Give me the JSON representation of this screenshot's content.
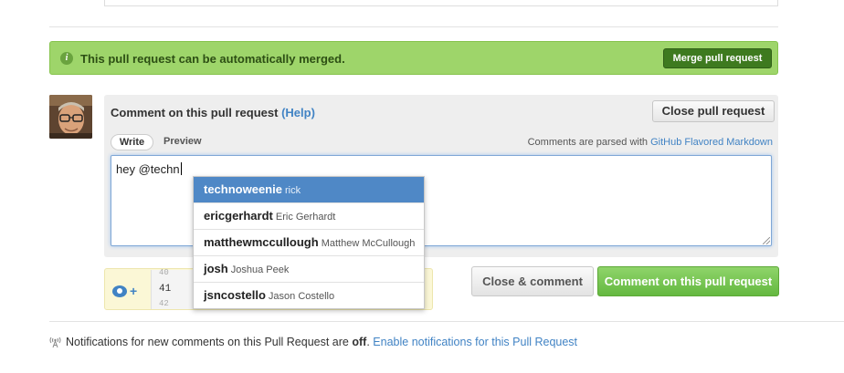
{
  "merge": {
    "message": "This pull request can be automatically merged.",
    "button_label": "Merge pull request",
    "info_glyph": "i",
    "icon": "info-icon"
  },
  "comment": {
    "title": "Comment on this pull request",
    "help_link": "(Help)",
    "close_button": "Close pull request",
    "tabs": [
      {
        "label": "Write",
        "selected": true
      },
      {
        "label": "Preview",
        "selected": false
      }
    ],
    "markdown_note": "Comments are parsed with",
    "markdown_link": "GitHub Flavored Markdown",
    "textarea_value": "hey @techn"
  },
  "suggestions": [
    {
      "login": "technoweenie",
      "name": "rick",
      "active": true
    },
    {
      "login": "ericgerhardt",
      "name": "Eric Gerhardt",
      "active": false
    },
    {
      "login": "matthewmccullough",
      "name": "Matthew McCullough",
      "active": false
    },
    {
      "login": "josh",
      "name": "Joshua Peek",
      "active": false
    },
    {
      "login": "jsncostello",
      "name": "Jason Costello",
      "active": false
    }
  ],
  "diff_preview": {
    "plus_glyph": "+",
    "line_numbers": [
      "40",
      "41",
      "42"
    ],
    "icon": "eye-icon"
  },
  "actions": {
    "close_and_comment": "Close & comment",
    "comment": "Comment on this pull request"
  },
  "notifications": {
    "text_before": "Notifications for new comments on this Pull Request are",
    "status": "off",
    "text_after": ".",
    "link": "Enable notifications for this Pull Request",
    "icon": "broadcast-icon"
  },
  "colors": {
    "merge_bar": "#9ed56a",
    "merge_button": "#3e7a1f",
    "link": "#4183c4",
    "suggestion_active": "#4f88c6",
    "comment_button": "#64b840"
  }
}
